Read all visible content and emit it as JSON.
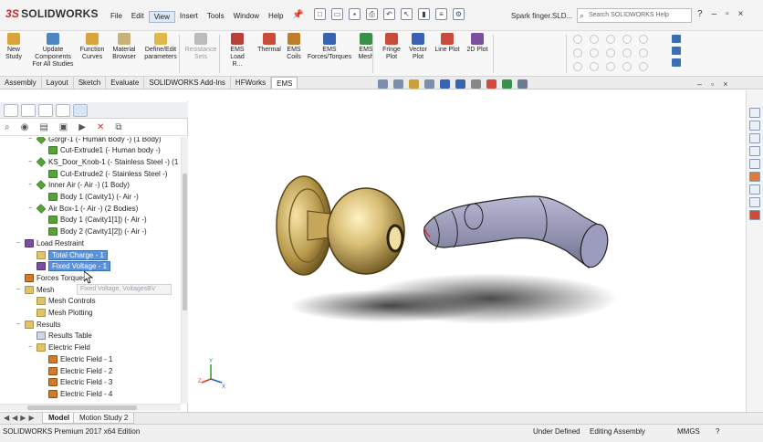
{
  "app": {
    "brand_ds": "3S",
    "brand": "SOLIDWORKS",
    "doc_title": "Spark finger.SLD...",
    "search_placeholder": "Search SOLIDWORKS Help",
    "window_controls": [
      "?",
      "–",
      "▫",
      "×"
    ]
  },
  "menu": [
    "File",
    "Edit",
    "View",
    "Insert",
    "Tools",
    "Window",
    "Help"
  ],
  "menu_active": "View",
  "ribbon": {
    "buttons": [
      {
        "label": "New\nStudy",
        "icon": "new-study-icon",
        "color": "#d9a43a"
      },
      {
        "label": "Update\nComponents\nFor All Studies",
        "icon": "update-components-icon",
        "color": "#4c86c9"
      },
      {
        "label": "Function\nCurves",
        "icon": "function-curves-icon",
        "color": "#d9a43a"
      },
      {
        "label": "Material\nBrowser",
        "icon": "material-browser-icon",
        "color": "#c8b27a"
      },
      {
        "label": "Define/Edit\nparameters",
        "icon": "parameters-icon",
        "color": "#e0b84a"
      },
      {
        "label": "Resistance\nSets",
        "icon": "resistance-sets-icon",
        "color": "#bcbcbc",
        "disabled": true
      },
      {
        "label": "EMS\nLoad R...",
        "icon": "ems-load-icon",
        "color": "#b9403a"
      },
      {
        "label": "Thermal",
        "icon": "thermal-icon",
        "color": "#c94b3a"
      },
      {
        "label": "EMS\nCoils",
        "icon": "ems-coils-icon",
        "color": "#c07d2a"
      },
      {
        "label": "EMS\nForces/Torques",
        "icon": "ems-forces-icon",
        "color": "#3a62b3"
      },
      {
        "label": "EMS\nMesh",
        "icon": "ems-mesh-icon",
        "color": "#3a8f4a"
      },
      {
        "label": "Fringe\nPlot",
        "icon": "fringe-plot-icon",
        "color": "#c94b3a"
      },
      {
        "label": "Vector\nPlot",
        "icon": "vector-plot-icon",
        "color": "#3a62b3"
      },
      {
        "label": "Line Plot",
        "icon": "line-plot-icon",
        "color": "#c94b3a"
      },
      {
        "label": "2D Plot",
        "icon": "2d-plot-icon",
        "color": "#7b4fa0"
      }
    ]
  },
  "tabs": [
    "Assembly",
    "Layout",
    "Sketch",
    "Evaluate",
    "SOLIDWORKS Add-Ins",
    "HFWorks",
    "EMS"
  ],
  "tabs_active": "EMS",
  "tree": [
    {
      "label": "Gorgr-1  (- Human Body -)  (1 Body)",
      "indent": 1,
      "icon": "grp",
      "exp": "−"
    },
    {
      "label": "Cut-Extrude1   (- Human body -)",
      "indent": 2,
      "icon": "body"
    },
    {
      "label": "KS_Door_Knob-1  (- Stainless Steel -)  (1",
      "indent": 1,
      "icon": "grp",
      "exp": "−"
    },
    {
      "label": "Cut-Extrude2   (- Stainless Steel -)",
      "indent": 2,
      "icon": "body"
    },
    {
      "label": "Inner Air   (- Air -)   (1 Body)",
      "indent": 1,
      "icon": "grp",
      "exp": "−"
    },
    {
      "label": "Body 1 (Cavity1)   (- Air -)",
      "indent": 2,
      "icon": "body"
    },
    {
      "label": "Air Box-1   (- Air -)   (2 Bodies)",
      "indent": 1,
      "icon": "grp",
      "exp": "−"
    },
    {
      "label": "Body 1 (Cavity1[1])   (- Air -)",
      "indent": 2,
      "icon": "body"
    },
    {
      "label": "Body 2 (Cavity1[2])   (- Air -)",
      "indent": 2,
      "icon": "body"
    },
    {
      "label": "Load Restraint",
      "indent": 0,
      "icon": "res",
      "exp": "−"
    },
    {
      "label": "Total Charge - 1",
      "indent": 1,
      "icon": "folder",
      "selected": true
    },
    {
      "label": "Fixed Voltage - 1",
      "indent": 1,
      "icon": "res",
      "selected": true
    },
    {
      "label": "Forces Torques",
      "indent": 0,
      "icon": "efield"
    },
    {
      "label": "Mesh",
      "indent": 0,
      "icon": "folder",
      "exp": "−"
    },
    {
      "label": "Mesh Controls",
      "indent": 1,
      "icon": "folder"
    },
    {
      "label": "Mesh Plotting",
      "indent": 1,
      "icon": "folder"
    },
    {
      "label": "Results",
      "indent": 0,
      "icon": "folder",
      "exp": "−"
    },
    {
      "label": "Results Table",
      "indent": 1,
      "icon": "table"
    },
    {
      "label": "Electric Field",
      "indent": 1,
      "icon": "folder",
      "exp": "−"
    },
    {
      "label": "Electric Field - 1",
      "indent": 2,
      "icon": "efield"
    },
    {
      "label": "Electric Field - 2",
      "indent": 2,
      "icon": "efield"
    },
    {
      "label": "Electric Field - 3",
      "indent": 2,
      "icon": "efield"
    },
    {
      "label": "Electric Field - 4",
      "indent": 2,
      "icon": "efield"
    }
  ],
  "tooltip": "Fixed Voltage, VoltagesBV",
  "bottom_tabs": [
    "Model",
    "Motion Study 2"
  ],
  "bottom_tabs_active": "Model",
  "status": {
    "left": "SOLIDWORKS Premium 2017 x64 Edition",
    "mid1": "Under Defined",
    "mid2": "Editing Assembly",
    "units": "MMGS"
  }
}
